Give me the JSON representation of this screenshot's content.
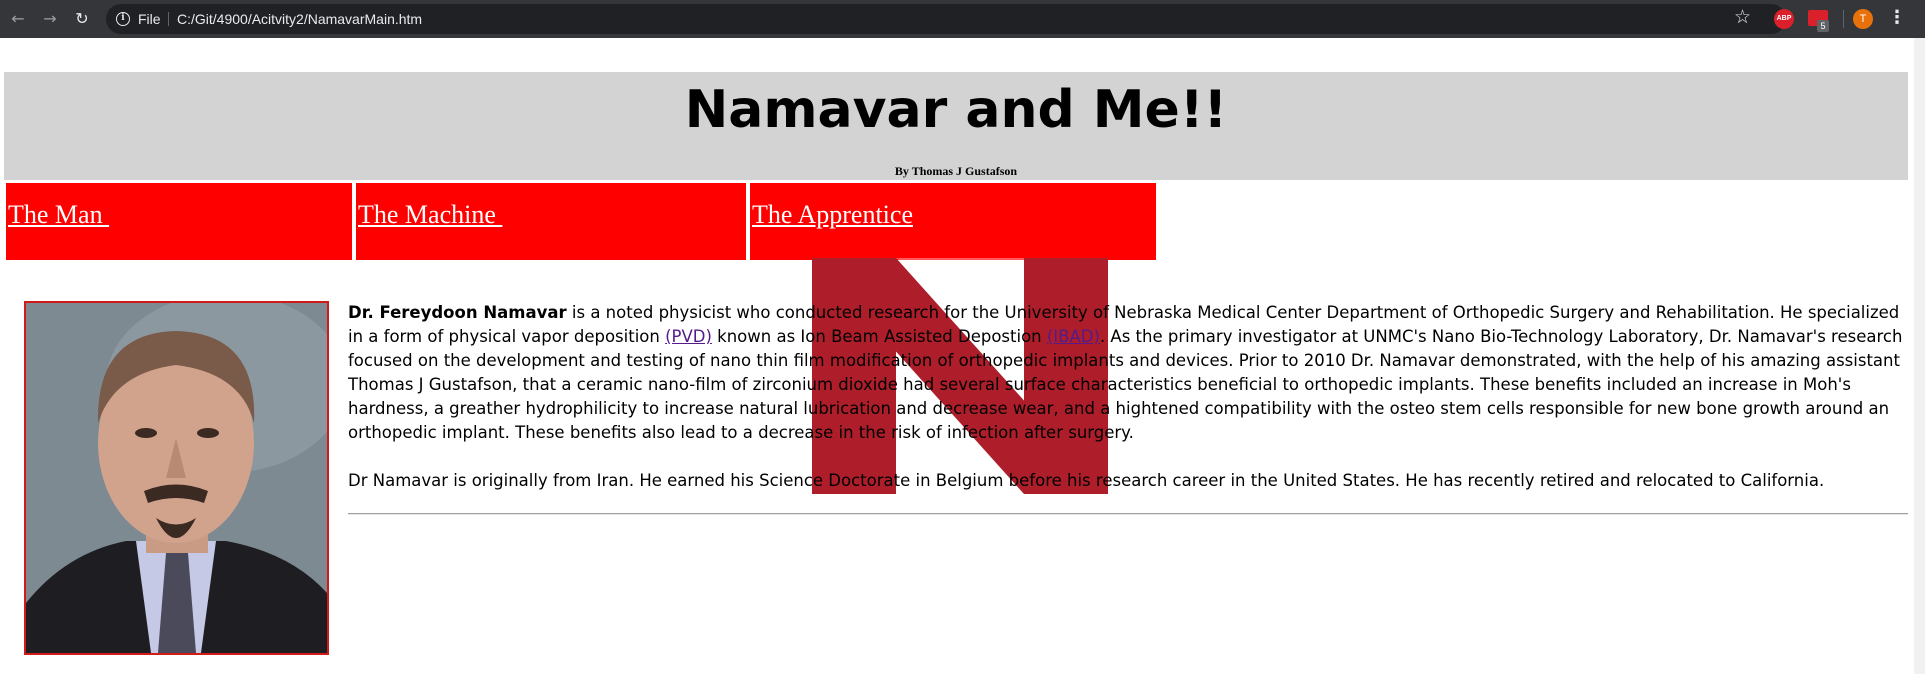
{
  "browser": {
    "scheme_label": "File",
    "url": "C:/Git/4900/Acitvity2/NamavarMain.htm",
    "icons": [
      "back-arrow-icon",
      "forward-arrow-icon",
      "reload-icon",
      "info-icon",
      "star-icon",
      "adblock-icon",
      "extension-icon",
      "menu-icon"
    ],
    "abp_label": "ABP",
    "extension_badge": "5",
    "avatar_letter": "T",
    "colors": {
      "toolbar": "#35363a",
      "omnibox": "#202124",
      "avatar": "#e8710a",
      "abp": "#d9202b"
    }
  },
  "header": {
    "title": "Namavar and Me!!",
    "byline": "By Thomas J Gustafson",
    "background": "#d3d3d3"
  },
  "nav": {
    "items": [
      {
        "label": "The Man "
      },
      {
        "label": "The Machine "
      },
      {
        "label": "The Apprentice"
      }
    ],
    "background": "#ff0000",
    "text_color": "#ffffff"
  },
  "watermark": {
    "icon": "university-n-logo",
    "color": "#ad1e2a"
  },
  "profile_photo": {
    "border_color": "#d21a1a"
  },
  "article": {
    "name": "Dr. Fereydoon Namavar",
    "p1_a": " is a noted physicist who conducted research for the University of Nebraska Medical Center Department of Orthopedic Surgery and Rehabilitation. He specialized in a form of physical vapor deposition ",
    "link_pvd": "(PVD)",
    "p1_b": " known as Ion Beam Assisted Depostion ",
    "link_ibad": "(IBAD)",
    "p1_c": ". As the primary investigator at UNMC's Nano Bio-Technology Laboratory, Dr. Namavar's research focused on the development and testing of nano thin film modification of orthopedic implants and devices. Prior to 2010 Dr. Namavar demonstrated, with the help of his amazing assistant Thomas J Gustafson, that a ceramic nano-film of zirconium dioxide had several surface characteristics beneficial to orthopedic implants. These benefits included an increase in Moh's hardness, a greather hydrophilicity to increase natural lubrication and decrease wear, and a hightened compatibility with the osteo stem cells responsible for new bone growth around an orthopedic implant. These benefits also lead to a decrease in the risk of infection after surgery.",
    "p2": "Dr Namavar is originally from Iran. He earned his Science Doctorate in Belgium before his research career in the United States. He has recently retired and relocated to California."
  }
}
